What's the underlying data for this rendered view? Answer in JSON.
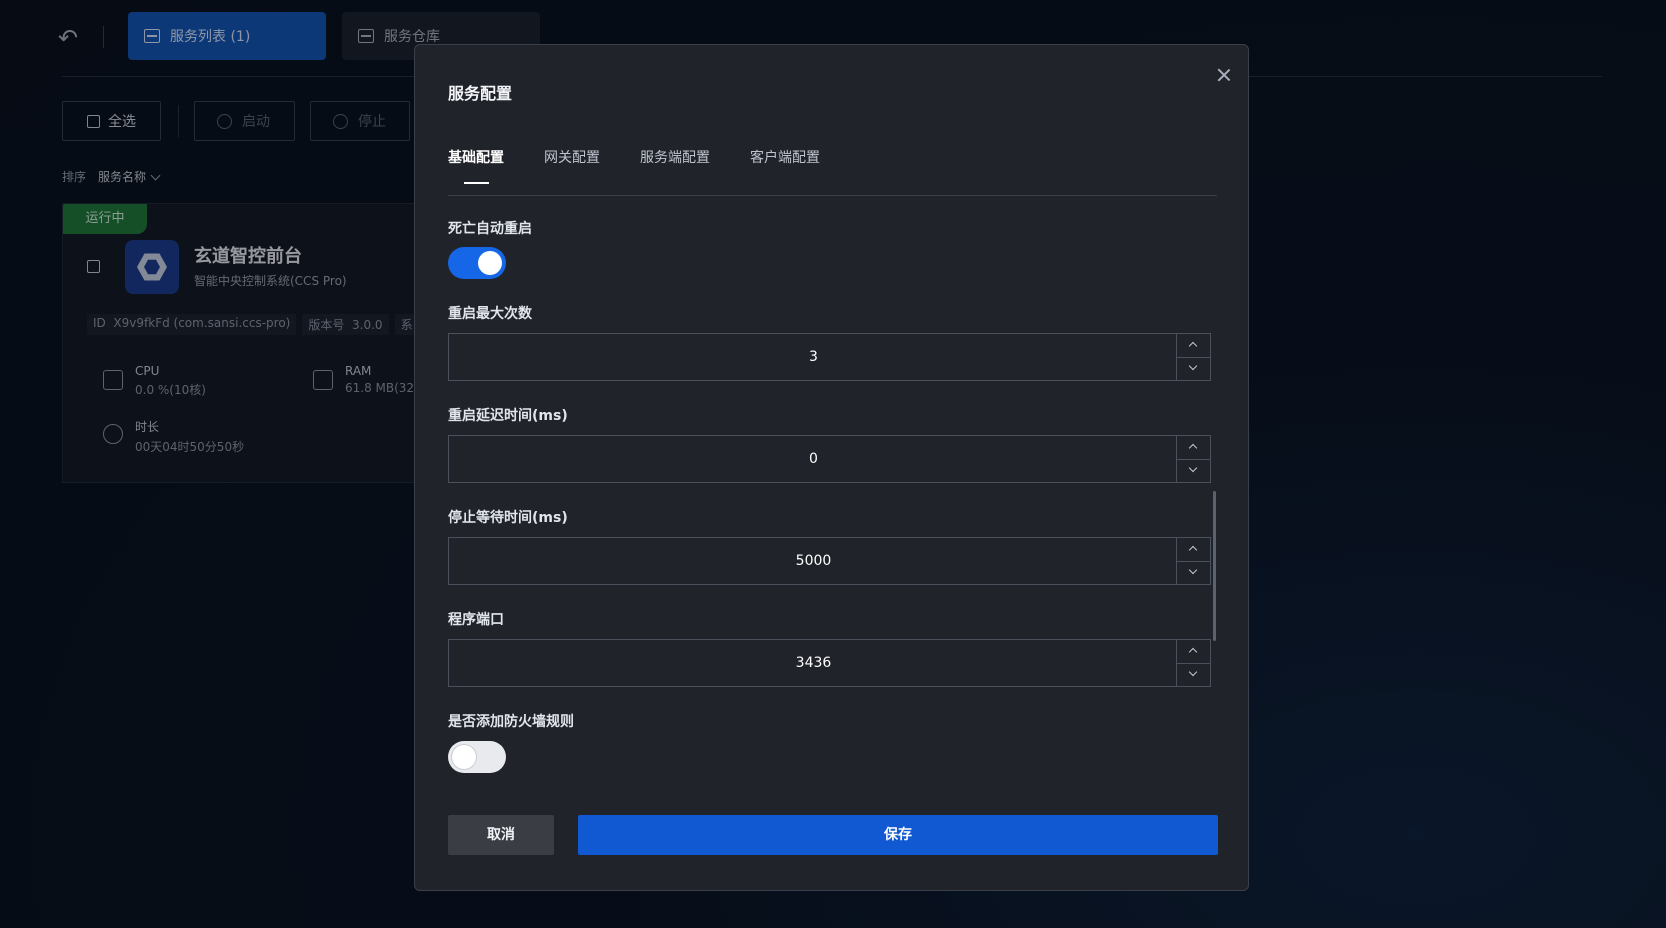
{
  "header": {
    "tabs": [
      {
        "label": "服务列表 (1)",
        "active": true
      },
      {
        "label": "服务仓库",
        "active": false
      }
    ]
  },
  "toolbar": {
    "select_all": "全选",
    "start": "启动",
    "stop": "停止"
  },
  "sort": {
    "label": "排序",
    "value": "服务名称"
  },
  "service_card": {
    "status": "运行中",
    "name": "玄道智控前台",
    "subtitle": "智能中央控制系统(CCS Pro)",
    "id_label": "ID",
    "id_value": "X9v9fkFd (com.sansi.ccs-pro)",
    "version_label": "版本号",
    "version_value": "3.0.0",
    "sys_label": "系",
    "cpu_label": "CPU",
    "cpu_value": "0.0 %(10核)",
    "ram_label": "RAM",
    "ram_value": "61.8 MB(32",
    "duration_label": "时长",
    "duration_value": "00天04时50分50秒"
  },
  "modal": {
    "title": "服务配置",
    "tabs": [
      "基础配置",
      "网关配置",
      "服务端配置",
      "客户端配置"
    ],
    "active_tab": "基础配置",
    "fields": {
      "auto_restart": {
        "label": "死亡自动重启",
        "on": true
      },
      "max_restarts": {
        "label": "重启最大次数",
        "value": "3"
      },
      "restart_delay": {
        "label": "重启延迟时间(ms)",
        "value": "0"
      },
      "stop_wait": {
        "label": "停止等待时间(ms)",
        "value": "5000"
      },
      "port": {
        "label": "程序端口",
        "value": "3436"
      },
      "firewall": {
        "label": "是否添加防火墙规则",
        "on": false
      }
    },
    "cancel": "取消",
    "save": "保存"
  },
  "colors": {
    "primary": "#1158d3",
    "switch_on": "#1666e8",
    "running_badge": "#1f7a3e",
    "modal_bg": "#202329"
  }
}
